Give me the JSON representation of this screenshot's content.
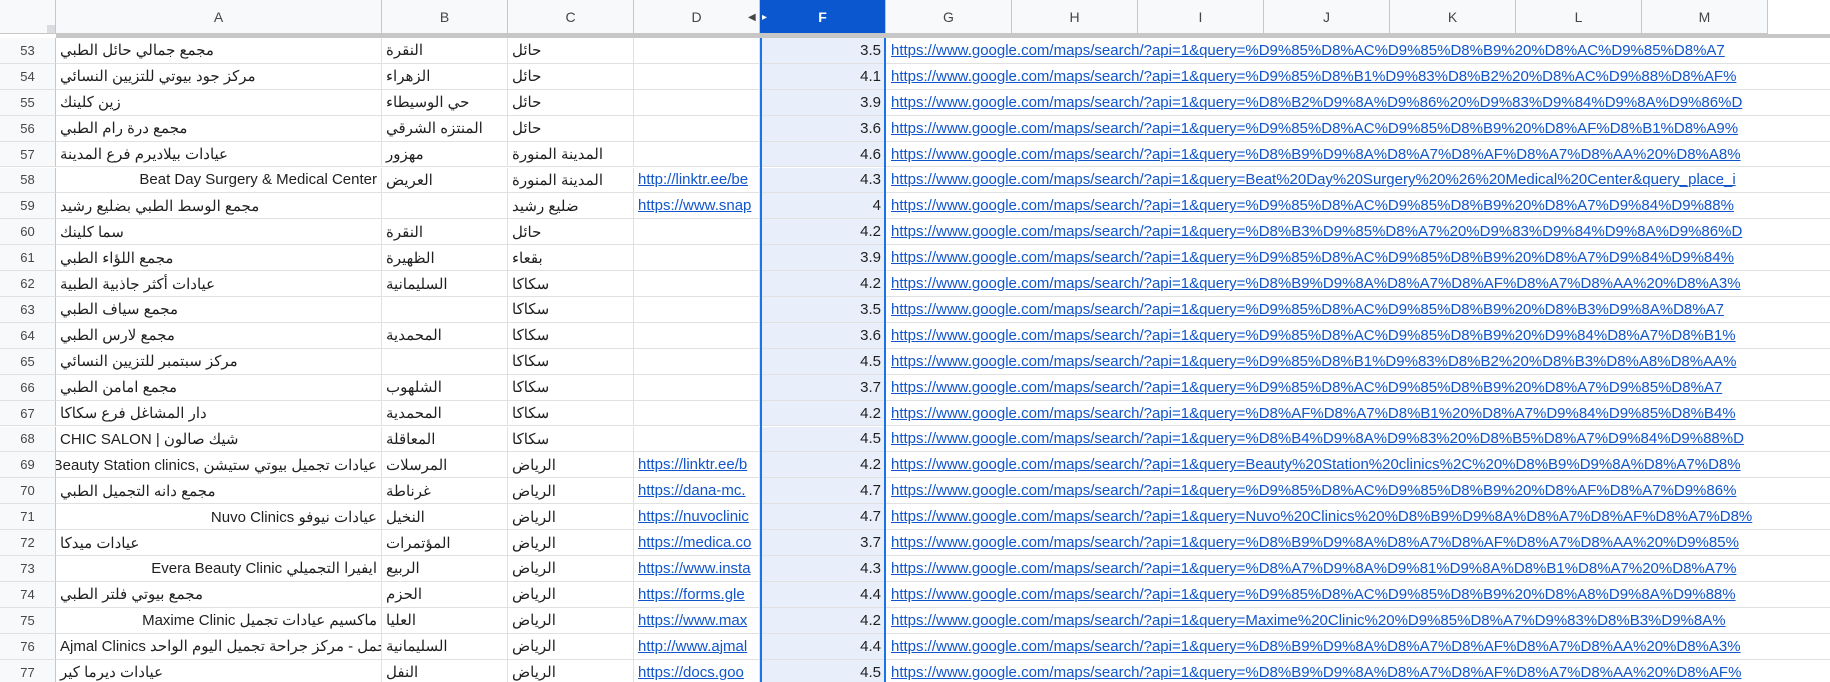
{
  "columns": [
    "A",
    "B",
    "C",
    "D",
    "F",
    "G",
    "H",
    "I",
    "J",
    "K",
    "L",
    "M"
  ],
  "selected_column": "F",
  "icons": {
    "col_d_menu": "triangle-left-icon",
    "col_f_handle": "drag-handle-icon"
  },
  "rows": [
    {
      "n": "53",
      "a": "مجمع جمالي حائل الطبي",
      "b": "النقرة",
      "c": "حائل",
      "d": "",
      "f": "3.5",
      "g": "https://www.google.com/maps/search/?api=1&query=%D9%85%D8%AC%D9%85%D8%B9%20%D8%AC%D9%85%D8%A7"
    },
    {
      "n": "54",
      "a": "مركز جود بيوتي للتزيين النسائي",
      "b": "الزهراء",
      "c": "حائل",
      "d": "",
      "f": "4.1",
      "g": "https://www.google.com/maps/search/?api=1&query=%D9%85%D8%B1%D9%83%D8%B2%20%D8%AC%D9%88%D8%AF%"
    },
    {
      "n": "55",
      "a": "زين كلينك",
      "b": "حي الوسيطاء",
      "c": "حائل",
      "d": "",
      "f": "3.9",
      "g": "https://www.google.com/maps/search/?api=1&query=%D8%B2%D9%8A%D9%86%20%D9%83%D9%84%D9%8A%D9%86%D"
    },
    {
      "n": "56",
      "a": "مجمع درة رام الطبي",
      "b": "المنتزه الشرقي",
      "c": "حائل",
      "d": "",
      "f": "3.6",
      "g": "https://www.google.com/maps/search/?api=1&query=%D9%85%D8%AC%D9%85%D8%B9%20%D8%AF%D8%B1%D8%A9%"
    },
    {
      "n": "57",
      "a": "عيادات بيلاديرم فرع المدينة",
      "b": "مهزور",
      "c": "المدينة المنورة",
      "d": "",
      "f": "4.6",
      "g": "https://www.google.com/maps/search/?api=1&query=%D8%B9%D9%8A%D8%A7%D8%AF%D8%A7%D8%AA%20%D8%A8%"
    },
    {
      "n": "58",
      "a": "Beat Day Surgery & Medical Center",
      "b": "العريض",
      "c": "المدينة المنورة",
      "d": "http://linktr.ee/be",
      "f": "4.3",
      "g": "https://www.google.com/maps/search/?api=1&query=Beat%20Day%20Surgery%20%26%20Medical%20Center&query_place_i"
    },
    {
      "n": "59",
      "a": "مجمع الوسط الطبي بضليع رشيد",
      "b": "",
      "c": "ضليع رشيد",
      "d": "https://www.snap",
      "f": "4",
      "g": "https://www.google.com/maps/search/?api=1&query=%D9%85%D8%AC%D9%85%D8%B9%20%D8%A7%D9%84%D9%88%"
    },
    {
      "n": "60",
      "a": "سما كلينك",
      "b": "النقرة",
      "c": "حائل",
      "d": "",
      "f": "4.2",
      "g": "https://www.google.com/maps/search/?api=1&query=%D8%B3%D9%85%D8%A7%20%D9%83%D9%84%D9%8A%D9%86%D"
    },
    {
      "n": "61",
      "a": "مجمع اللؤاء الطبي",
      "b": "الظهيرة",
      "c": "بقعاء",
      "d": "",
      "f": "3.9",
      "g": "https://www.google.com/maps/search/?api=1&query=%D9%85%D8%AC%D9%85%D8%B9%20%D8%A7%D9%84%D9%84%"
    },
    {
      "n": "62",
      "a": "عيادات أكثر جاذبية الطبية",
      "b": "السليمانية",
      "c": "سكاكا",
      "d": "",
      "f": "4.2",
      "g": "https://www.google.com/maps/search/?api=1&query=%D8%B9%D9%8A%D8%A7%D8%AF%D8%A7%D8%AA%20%D8%A3%"
    },
    {
      "n": "63",
      "a": "مجمع سياف الطبي",
      "b": "",
      "c": "سكاكا",
      "d": "",
      "f": "3.5",
      "g": "https://www.google.com/maps/search/?api=1&query=%D9%85%D8%AC%D9%85%D8%B9%20%D8%B3%D9%8A%D8%A7"
    },
    {
      "n": "64",
      "a": "مجمع لارس الطبي",
      "b": "المحمدية",
      "c": "سكاكا",
      "d": "",
      "f": "3.6",
      "g": "https://www.google.com/maps/search/?api=1&query=%D9%85%D8%AC%D9%85%D8%B9%20%D9%84%D8%A7%D8%B1%"
    },
    {
      "n": "65",
      "a": "مركز سبتمبر للتزيين النسائي",
      "b": "",
      "c": "سكاكا",
      "d": "",
      "f": "4.5",
      "g": "https://www.google.com/maps/search/?api=1&query=%D9%85%D8%B1%D9%83%D8%B2%20%D8%B3%D8%A8%D8%AA%"
    },
    {
      "n": "66",
      "a": "مجمع امامن الطبي",
      "b": "الشلهوب",
      "c": "سكاكا",
      "d": "",
      "f": "3.7",
      "g": "https://www.google.com/maps/search/?api=1&query=%D9%85%D8%AC%D9%85%D8%B9%20%D8%A7%D9%85%D8%A7"
    },
    {
      "n": "67",
      "a": "دار المشاغل فرع سكاكا",
      "b": "المحمدية",
      "c": "سكاكا",
      "d": "",
      "f": "4.2",
      "g": "https://www.google.com/maps/search/?api=1&query=%D8%AF%D8%A7%D8%B1%20%D8%A7%D9%84%D9%85%D8%B4%"
    },
    {
      "n": "68",
      "a": "شيك صالون | CHIC SALON",
      "b": "المعاقلة",
      "c": "سكاكا",
      "d": "",
      "f": "4.5",
      "g": "https://www.google.com/maps/search/?api=1&query=%D8%B4%D9%8A%D9%83%20%D8%B5%D8%A7%D9%84%D9%88%D"
    },
    {
      "n": "69",
      "a": "Beauty Station clinics, عيادات تجميل بيوتي ستيشن",
      "b": "المرسلات",
      "c": "الرياض",
      "d": "https://linktr.ee/b",
      "f": "4.2",
      "g": "https://www.google.com/maps/search/?api=1&query=Beauty%20Station%20clinics%2C%20%D8%B9%D9%8A%D8%A7%D8%"
    },
    {
      "n": "70",
      "a": "مجمع دانه التجميل الطبي",
      "b": "غرناطة",
      "c": "الرياض",
      "d": "https://dana-mc.",
      "f": "4.7",
      "g": "https://www.google.com/maps/search/?api=1&query=%D9%85%D8%AC%D9%85%D8%B9%20%D8%AF%D8%A7%D9%86%"
    },
    {
      "n": "71",
      "a": "Nuvo Clinics عيادات نيوفو",
      "b": "النخيل",
      "c": "الرياض",
      "d": "https://nuvoclinic",
      "f": "4.7",
      "g": "https://www.google.com/maps/search/?api=1&query=Nuvo%20Clinics%20%D8%B9%D9%8A%D8%A7%D8%AF%D8%A7%D8%"
    },
    {
      "n": "72",
      "a": "عيادات ميدكا",
      "b": "المؤتمرات",
      "c": "الرياض",
      "d": "https://medica.co",
      "f": "3.7",
      "g": "https://www.google.com/maps/search/?api=1&query=%D8%B9%D9%8A%D8%A7%D8%AF%D8%A7%D8%AA%20%D9%85%"
    },
    {
      "n": "73",
      "a": "Evera Beauty Clinic ايفيرا التجميلي",
      "b": "الربيع",
      "c": "الرياض",
      "d": "https://www.insta",
      "f": "4.3",
      "g": "https://www.google.com/maps/search/?api=1&query=%D8%A7%D9%8A%D9%81%D9%8A%D8%B1%D8%A7%20%D8%A7%"
    },
    {
      "n": "74",
      "a": "مجمع بيوتي فلتر الطبي",
      "b": "الحزم",
      "c": "الرياض",
      "d": "https://forms.gle",
      "f": "4.4",
      "g": "https://www.google.com/maps/search/?api=1&query=%D9%85%D8%AC%D9%85%D8%B9%20%D8%A8%D9%8A%D9%88%"
    },
    {
      "n": "75",
      "a": "Maxime Clinic ماكسيم عيادات تجميل",
      "b": "العليا",
      "c": "الرياض",
      "d": "https://www.max",
      "f": "4.2",
      "g": "https://www.google.com/maps/search/?api=1&query=Maxime%20Clinic%20%D9%85%D8%A7%D9%83%D8%B3%D9%8A%"
    },
    {
      "n": "76",
      "a": "عيادات أجمل - مركز جراحة تجميل اليوم الواحد Ajmal Clinics",
      "b": "السليمانية",
      "c": "الرياض",
      "d": "http://www.ajmal",
      "f": "4.4",
      "g": "https://www.google.com/maps/search/?api=1&query=%D8%B9%D9%8A%D8%A7%D8%AF%D8%A7%D8%AA%20%D8%A3%"
    },
    {
      "n": "77",
      "a": "عيادات ديرما كير",
      "b": "النفل",
      "c": "الرياض",
      "d": "https://docs.goo",
      "f": "4.5",
      "g": "https://www.google.com/maps/search/?api=1&query=%D8%B9%D9%8A%D8%A7%D8%AF%D8%A7%D8%AA%20%D8%AF%"
    }
  ]
}
